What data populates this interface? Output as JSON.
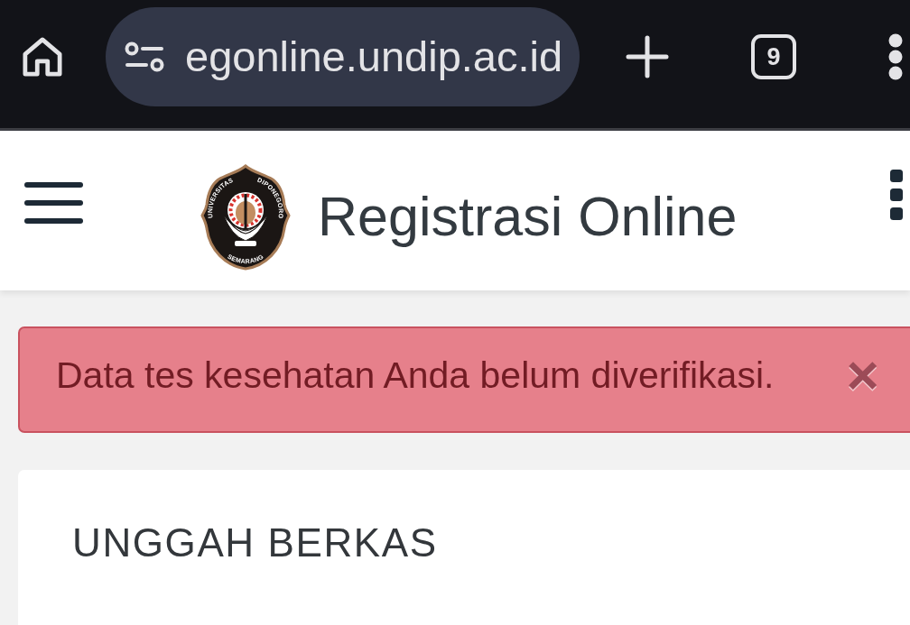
{
  "browser": {
    "url": "egonline.undip.ac.id",
    "tab_count": "9"
  },
  "header": {
    "logo": {
      "left_arc": "UNIVERSITAS",
      "right_arc": "DIPONEGORO",
      "bottom_arc": "SEMARANG"
    },
    "title": "Registrasi Online"
  },
  "alert": {
    "message": "Data tes kesehatan Anda belum diverifikasi.",
    "close": "×"
  },
  "card": {
    "title": "UNGGAH BERKAS"
  }
}
